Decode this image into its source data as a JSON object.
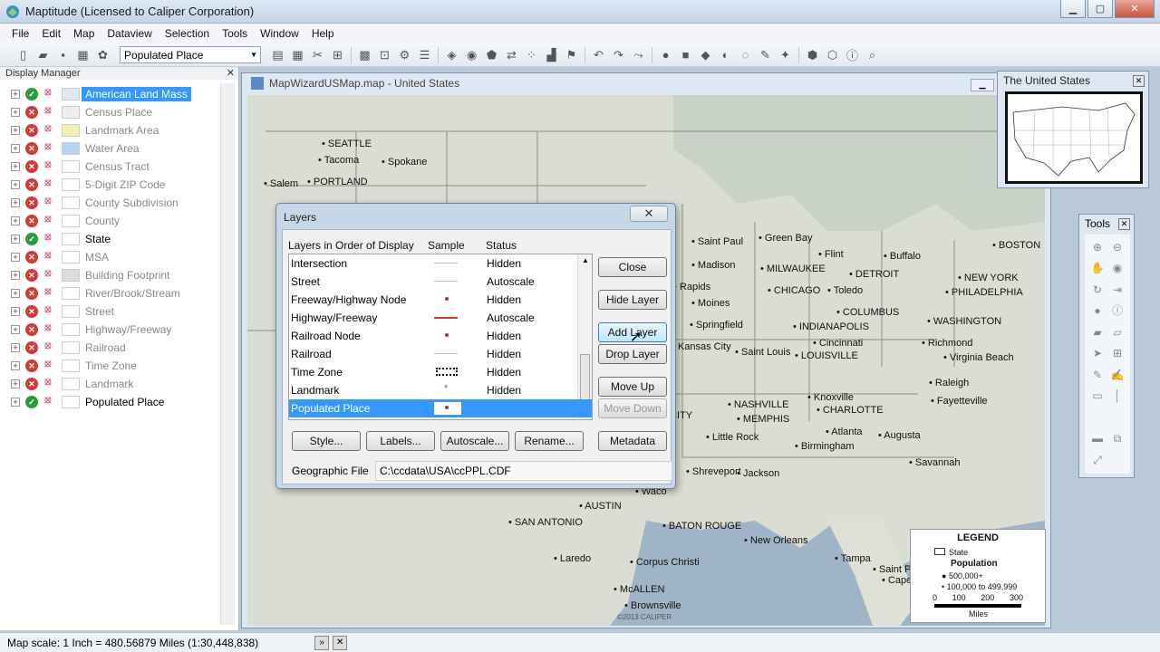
{
  "window": {
    "title": "Maptitude (Licensed to Caliper Corporation)"
  },
  "menu": [
    "File",
    "Edit",
    "Map",
    "Dataview",
    "Selection",
    "Tools",
    "Window",
    "Help"
  ],
  "toolbar": {
    "layer_select": "Populated Place"
  },
  "display_manager": {
    "title": "Display Manager",
    "layers": [
      {
        "name": "American Land Mass",
        "visible": true,
        "color": "#dfe7ef",
        "selected": true
      },
      {
        "name": "Census Place",
        "visible": false,
        "color": "#eeeeee"
      },
      {
        "name": "Landmark Area",
        "visible": false,
        "color": "#f3efb8"
      },
      {
        "name": "Water Area",
        "visible": false,
        "color": "#b7d3ef"
      },
      {
        "name": "Census Tract",
        "visible": false,
        "color": "#ffffff"
      },
      {
        "name": "5-Digit ZIP Code",
        "visible": false,
        "color": "#ffffff"
      },
      {
        "name": "County Subdivision",
        "visible": false,
        "color": "#ffffff"
      },
      {
        "name": "County",
        "visible": false,
        "color": "#ffffff"
      },
      {
        "name": "State",
        "visible": true,
        "color": "#ffffff",
        "shown": true
      },
      {
        "name": "MSA",
        "visible": false,
        "color": "#ffffff"
      },
      {
        "name": "Building Footprint",
        "visible": false,
        "color": "#dddddd"
      },
      {
        "name": "River/Brook/Stream",
        "visible": false,
        "color": "#ffffff"
      },
      {
        "name": "Street",
        "visible": false,
        "color": "#ffffff"
      },
      {
        "name": "Highway/Freeway",
        "visible": false,
        "color": "#ffffff"
      },
      {
        "name": "Railroad",
        "visible": false,
        "color": "#ffffff"
      },
      {
        "name": "Time Zone",
        "visible": false,
        "color": "#ffffff"
      },
      {
        "name": "Landmark",
        "visible": false,
        "color": "#ffffff"
      },
      {
        "name": "Populated Place",
        "visible": true,
        "color": "#ffffff",
        "shown": true
      }
    ]
  },
  "map_window": {
    "title": "MapWizardUSMap.map - United States",
    "copyright": "©2013 CALIPER"
  },
  "cities": [
    "SEATTLE",
    "Tacoma",
    "Spokane",
    "Salem",
    "PORTLAND",
    "Saint Paul",
    "Green Bay",
    "BOSTON",
    "Madison",
    "Flint",
    "Buffalo",
    "MILWAUKEE",
    "DETROIT",
    "NEW YORK",
    "Rapids",
    "CHICAGO",
    "Toledo",
    "PHILADELPHIA",
    "Moines",
    "COLUMBUS",
    "WASHINGTON",
    "Springfield",
    "INDIANAPOLIS",
    "Cincinnati",
    "Richmond",
    "Kansas City",
    "Saint Louis",
    "LOUISVILLE",
    "Virginia Beach",
    "Raleigh",
    "Knoxville",
    "NASHVILLE",
    "CHARLOTTE",
    "Fayetteville",
    "A CITY",
    "MEMPHIS",
    "Little Rock",
    "Atlanta",
    "Augusta",
    "Birmingham",
    "Savannah",
    "Shreveport",
    "Jackson",
    "Waco",
    "AUSTIN",
    "BATON ROUGE",
    "SAN ANTONIO",
    "New Orleans",
    "Tampa",
    "Saint Pe",
    "Laredo",
    "Corpus Christi",
    "McALLEN",
    "Brownsville",
    "Cape"
  ],
  "overview": {
    "title": "The United States"
  },
  "tools": {
    "title": "Tools"
  },
  "layers_dialog": {
    "title": "Layers",
    "header": "Layers in Order of Display",
    "col_sample": "Sample",
    "col_status": "Status",
    "rows": [
      {
        "name": "Intersection",
        "status": "Hidden"
      },
      {
        "name": "Street",
        "status": "Autoscale"
      },
      {
        "name": "Freeway/Highway Node",
        "status": "Hidden"
      },
      {
        "name": "Highway/Freeway",
        "status": "Autoscale"
      },
      {
        "name": "Railroad Node",
        "status": "Hidden"
      },
      {
        "name": "Railroad",
        "status": "Hidden"
      },
      {
        "name": "Time Zone",
        "status": "Hidden"
      },
      {
        "name": "Landmark",
        "status": "Hidden"
      },
      {
        "name": "Populated Place",
        "status": ""
      }
    ],
    "buttons": {
      "close": "Close",
      "hide": "Hide Layer",
      "add": "Add Layer",
      "drop": "Drop Layer",
      "move_up": "Move Up",
      "move_down": "Move Down",
      "metadata": "Metadata",
      "style": "Style...",
      "labels": "Labels...",
      "autoscale": "Autoscale...",
      "rename": "Rename..."
    },
    "geo_file_label": "Geographic File",
    "geo_file_value": "C:\\ccdata\\USA\\ccPPL.CDF"
  },
  "legend": {
    "title": "LEGEND",
    "state": "State",
    "population": "Population",
    "p1": "500,000+",
    "p2": "100,000 to 499,999",
    "scale": [
      "0",
      "100",
      "200",
      "300"
    ],
    "unit": "Miles"
  },
  "status": {
    "text": "Map scale: 1 Inch = 480.56879 Miles (1:30,448,838)"
  }
}
